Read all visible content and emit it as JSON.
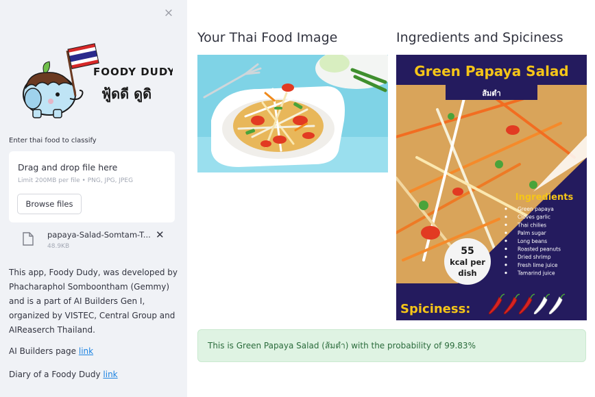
{
  "sidebar": {
    "close_icon": "×",
    "logo": {
      "brand": "FOODY DUDY",
      "thai_name": "ฟู้ดดี ดูดิ"
    },
    "uploader_label": "Enter thai food to classify",
    "dropzone_title": "Drag and drop file here",
    "dropzone_limit": "Limit 200MB per file • PNG, JPG, JPEG",
    "browse_label": "Browse files",
    "file": {
      "name": "papaya-Salad-Somtam-T...",
      "size": "48.9KB",
      "remove_icon": "✕"
    },
    "about": "This app, Foody Dudy, was developed by Phacharaphol Somboontham (Gemmy) and is a part of AI Builders Gen I, organized by VISTEC, Central Group and AIReaserch Thailand.",
    "links": [
      {
        "text": "AI Builders page ",
        "link": "link"
      },
      {
        "text": "Diary of a Foody Dudy ",
        "link": "link"
      }
    ]
  },
  "main": {
    "image_title": "Your Thai Food Image",
    "info_title": "Ingredients and Spiciness",
    "poster": {
      "title": "Green Papaya Salad",
      "thai": "ส้มตำ",
      "kcal_number": "55",
      "kcal_unit": "kcal per",
      "kcal_dish": "dish",
      "ingredients_title": "Ingredients",
      "ingredients": [
        "Green papaya",
        "Cloves garlic",
        "Thai chilies",
        "Palm sugar",
        "Long beans",
        "Roasted peanuts",
        "Dried shrimp",
        "Fresh lime juice",
        "Tamarind juice"
      ],
      "spiciness_label": "Spiciness:",
      "spiciness_level": 3,
      "spiciness_max": 5
    },
    "result": "This is Green Papaya Salad (ส้มตำ) with the probability of 99.83%"
  },
  "colors": {
    "sidebar_bg": "#f0f2f6",
    "link": "#1c83e1",
    "success_bg": "#dff3e3",
    "poster_bg": "#241b5e",
    "poster_yellow": "#f5c518"
  }
}
